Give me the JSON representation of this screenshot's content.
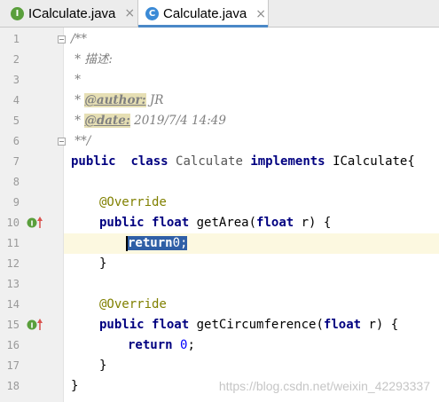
{
  "tabs": [
    {
      "icon_letter": "I",
      "icon_color": "#5a9f3c",
      "label": "ICalculate.java",
      "close": "×"
    },
    {
      "icon_letter": "C",
      "icon_color": "#3b8ad6",
      "label": "Calculate.java",
      "close": "×"
    }
  ],
  "line_numbers": [
    "1",
    "2",
    "3",
    "4",
    "5",
    "6",
    "7",
    "8",
    "9",
    "10",
    "11",
    "12",
    "13",
    "14",
    "15",
    "16",
    "17",
    "18"
  ],
  "code": {
    "l1": "/**",
    "l2": " * 描述:",
    "l3": " *",
    "l4_prefix": " * ",
    "l4_tag": "@author:",
    "l4_value": " JR",
    "l5_prefix": " * ",
    "l5_tag": "@date:",
    "l5_value": " 2019/7/4 14:49",
    "l6": " **/",
    "l7_kw1": "public",
    "l7_kw2": "class",
    "l7_name": "Calculate",
    "l7_kw3": "implements",
    "l7_iface": "ICalculate{",
    "l9": "@Override",
    "l10_kw1": "public",
    "l10_kw2": "float",
    "l10_name": "getArea(",
    "l10_kw3": "float",
    "l10_rest": " r) {",
    "l11_kw": "return",
    "l11_num": "0",
    "l11_semi": ";",
    "l12": "}",
    "l14": "@Override",
    "l15_kw1": "public",
    "l15_kw2": "float",
    "l15_name": "getCircumference(",
    "l15_kw3": "float",
    "l15_rest": " r) {",
    "l16_kw": "return",
    "l16_num": "0",
    "l16_semi": ";",
    "l17": "}",
    "l18": "}"
  },
  "watermark": "https://blog.csdn.net/weixin_42293337",
  "colors": {
    "keyword": "#000080",
    "annotation": "#808000",
    "number": "#0000ff",
    "doc_comment": "#808080",
    "selection": "#2f5fa6",
    "current_line": "#fcf8e0"
  }
}
